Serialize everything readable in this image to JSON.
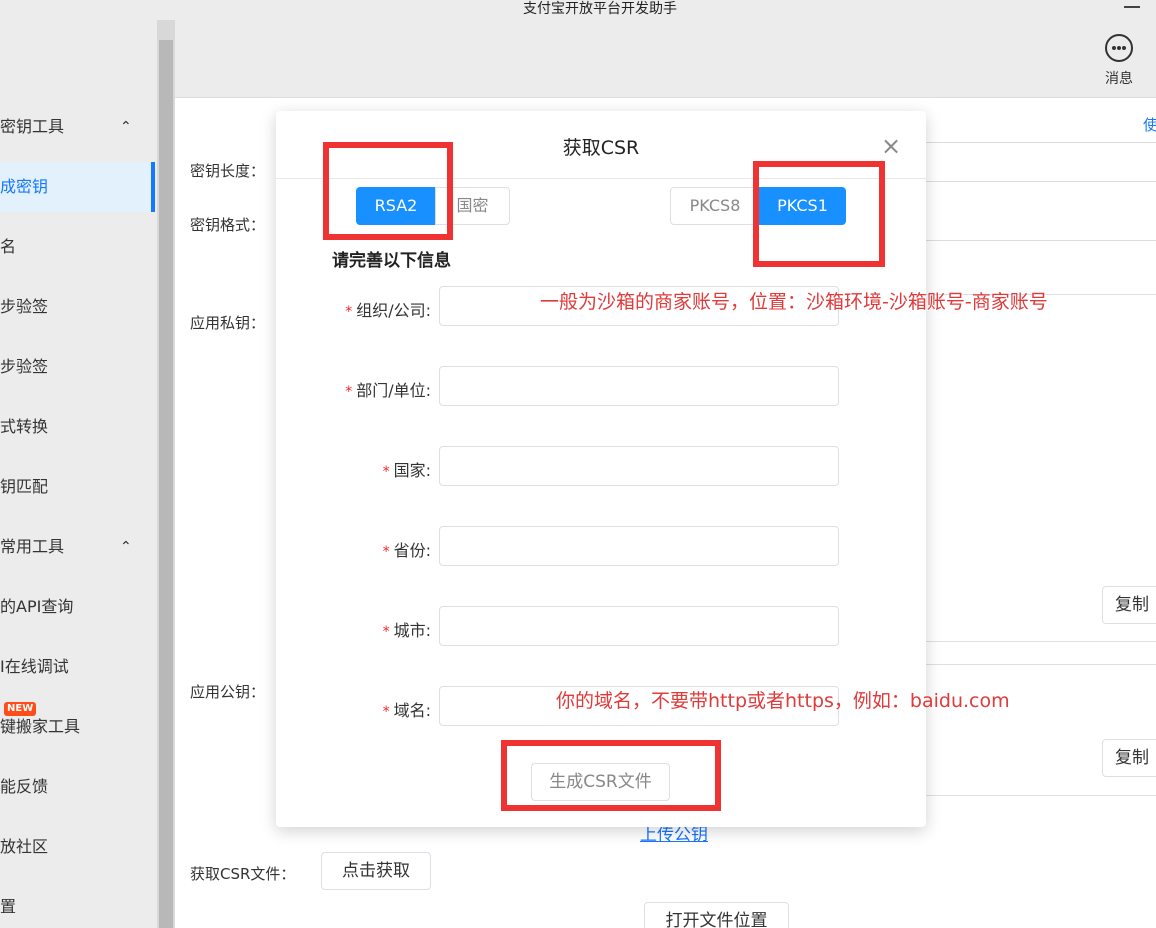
{
  "window": {
    "title": "支付宝开放平台开发助手"
  },
  "header": {
    "message_label": "消息",
    "message_icon": "chat-bubble-icon"
  },
  "sidebar": {
    "items": [
      {
        "label": "密钥工具",
        "type": "group",
        "chevron": "⌃"
      },
      {
        "label": "成密钥",
        "type": "item",
        "active": true
      },
      {
        "label": "名",
        "type": "item"
      },
      {
        "label": "步验签",
        "type": "item"
      },
      {
        "label": "步验签",
        "type": "item"
      },
      {
        "label": "式转换",
        "type": "item"
      },
      {
        "label": "钥匹配",
        "type": "item"
      },
      {
        "label": "常用工具",
        "type": "group",
        "chevron": "⌃"
      },
      {
        "label": "的API查询",
        "type": "item"
      },
      {
        "label": "I在线调试",
        "type": "item"
      },
      {
        "label": "键搬家工具",
        "type": "item",
        "badge": "NEW"
      },
      {
        "label": "能反馈",
        "type": "item"
      },
      {
        "label": "放社区",
        "type": "item"
      },
      {
        "label": "置",
        "type": "item"
      }
    ]
  },
  "main": {
    "key_length_label": "密钥长度：",
    "key_format_label": "密钥格式：",
    "private_key_label": "应用私钥：",
    "public_key_label": "应用公钥：",
    "copy_label": "复制",
    "upload_public_key": "上传公钥",
    "get_csr_label": "获取CSR文件：",
    "get_csr_button": "点击获取",
    "open_location_button": "打开文件位置",
    "right_edge_link": "使"
  },
  "modal": {
    "title": "获取CSR",
    "close": "×",
    "algorithms": [
      "RSA2",
      "国密"
    ],
    "selected_algorithm": "RSA2",
    "formats": [
      "PKCS8",
      "PKCS1"
    ],
    "selected_format": "PKCS1",
    "section_title": "请完善以下信息",
    "fields": [
      {
        "label": "组织/公司:",
        "value": ""
      },
      {
        "label": "部门/单位:",
        "value": ""
      },
      {
        "label": "国家:",
        "value": ""
      },
      {
        "label": "省份:",
        "value": ""
      },
      {
        "label": "城市:",
        "value": ""
      },
      {
        "label": "域名:",
        "value": ""
      }
    ],
    "required_mark": "*",
    "generate_button": "生成CSR文件"
  },
  "annotations": {
    "org_note": "一般为沙箱的商家账号，位置：沙箱环境-沙箱账号-商家账号",
    "domain_note": "你的域名，不要带http或者https，例如：baidu.com",
    "highlight_color": "#ef3333"
  }
}
